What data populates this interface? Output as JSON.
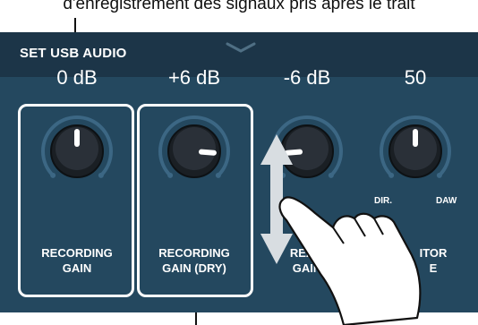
{
  "caption": "d'enregistrement des signaux pris après le trait",
  "header": {
    "title": "SET USB AUDIO"
  },
  "knobs": [
    {
      "value": "0 dB",
      "label_line1": "RECORDING",
      "label_line2": "GAIN",
      "level": 0.5
    },
    {
      "value": "+6 dB",
      "label_line1": "RECORDING",
      "label_line2": "GAIN (DRY)",
      "level": 0.85
    },
    {
      "value": "-6 dB",
      "label_line1": "REAM",
      "label_line2": "GAIN",
      "level": 0.15
    },
    {
      "value": "50",
      "label_line1": "ITOR",
      "label_line2": "E",
      "level": 0.5,
      "scale_left": "DIR.",
      "scale_right": "DAW"
    }
  ],
  "colors": {
    "panel": "#24485f",
    "header": "#1c3548",
    "knob": "#1a1f24",
    "frame": "#ffffff"
  },
  "icons": [
    "chevron-down-icon",
    "double-arrow-icon",
    "hand-pointer-icon"
  ]
}
